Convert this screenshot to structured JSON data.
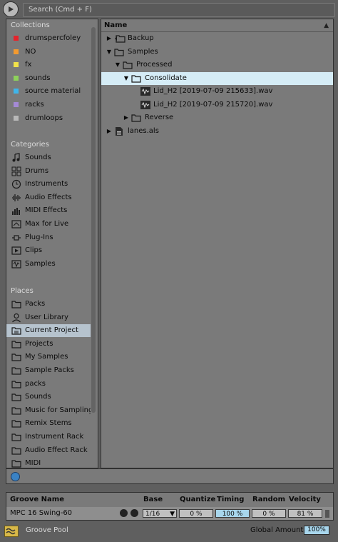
{
  "search": {
    "placeholder": "Search (Cmd + F)"
  },
  "sidebar": {
    "collections_title": "Collections",
    "collections": [
      {
        "label": "drumspercfoley",
        "color": "#e5242c"
      },
      {
        "label": "NO",
        "color": "#f39a2f"
      },
      {
        "label": "fx",
        "color": "#f2e24a"
      },
      {
        "label": "sounds",
        "color": "#8ed15a"
      },
      {
        "label": "source material",
        "color": "#3fb5ea"
      },
      {
        "label": "racks",
        "color": "#a58ad6"
      },
      {
        "label": "drumloops",
        "color": "#b8b8b8"
      }
    ],
    "categories_title": "Categories",
    "categories": [
      {
        "label": "Sounds",
        "icon": "note-icon"
      },
      {
        "label": "Drums",
        "icon": "drum-grid-icon"
      },
      {
        "label": "Instruments",
        "icon": "clock-icon"
      },
      {
        "label": "Audio Effects",
        "icon": "waveform-icon"
      },
      {
        "label": "MIDI Effects",
        "icon": "midi-bars-icon"
      },
      {
        "label": "Max for Live",
        "icon": "max-icon"
      },
      {
        "label": "Plug-Ins",
        "icon": "plug-icon"
      },
      {
        "label": "Clips",
        "icon": "clip-icon"
      },
      {
        "label": "Samples",
        "icon": "sample-icon"
      }
    ],
    "places_title": "Places",
    "places": [
      {
        "label": "Packs",
        "icon": "folder-icon"
      },
      {
        "label": "User Library",
        "icon": "user-icon"
      },
      {
        "label": "Current Project",
        "icon": "project-icon",
        "selected": true
      },
      {
        "label": "Projects",
        "icon": "folder-icon"
      },
      {
        "label": "My Samples",
        "icon": "folder-icon"
      },
      {
        "label": "Sample Packs",
        "icon": "folder-icon"
      },
      {
        "label": "packs",
        "icon": "folder-icon"
      },
      {
        "label": "Sounds",
        "icon": "folder-icon"
      },
      {
        "label": "Music for Sampling",
        "icon": "folder-icon"
      },
      {
        "label": "Remix Stems",
        "icon": "folder-icon"
      },
      {
        "label": "Instrument Rack",
        "icon": "folder-icon"
      },
      {
        "label": "Audio Effect Rack",
        "icon": "folder-icon"
      },
      {
        "label": "MIDI",
        "icon": "folder-icon"
      }
    ]
  },
  "files": {
    "header": "Name",
    "rows": [
      {
        "label": "Backup",
        "depth": 0,
        "expander": "collapsed",
        "icon": "backup-folder-icon"
      },
      {
        "label": "Samples",
        "depth": 0,
        "expander": "expanded",
        "icon": "folder-icon"
      },
      {
        "label": "Processed",
        "depth": 1,
        "expander": "expanded",
        "icon": "folder-icon"
      },
      {
        "label": "Consolidate",
        "depth": 2,
        "expander": "expanded",
        "icon": "folder-icon",
        "selected": true
      },
      {
        "label": "Lid_H2 [2019-07-09 215633].wav",
        "depth": 3,
        "expander": "none",
        "icon": "wav-file-icon"
      },
      {
        "label": "Lid_H2 [2019-07-09 215720].wav",
        "depth": 3,
        "expander": "none",
        "icon": "wav-file-icon"
      },
      {
        "label": "Reverse",
        "depth": 2,
        "expander": "collapsed",
        "icon": "folder-icon"
      },
      {
        "label": "lanes.als",
        "depth": 0,
        "expander": "collapsed",
        "icon": "als-file-icon"
      }
    ]
  },
  "groove": {
    "headers": {
      "name": "Groove Name",
      "base": "Base",
      "quantize": "Quantize",
      "timing": "Timing",
      "random": "Random",
      "velocity": "Velocity"
    },
    "row": {
      "name": "MPC 16 Swing-60",
      "base": "1/16",
      "quantize": "0 %",
      "timing": "100 %",
      "random": "0 %",
      "velocity": "81 %"
    },
    "pool_label": "Groove Pool",
    "global_amount_label": "Global Amount",
    "global_amount": "100%"
  },
  "colors": {
    "selection": "#d5ecf6",
    "accent_blue": "#a8d6ec",
    "panel": "#7a7a7a"
  }
}
